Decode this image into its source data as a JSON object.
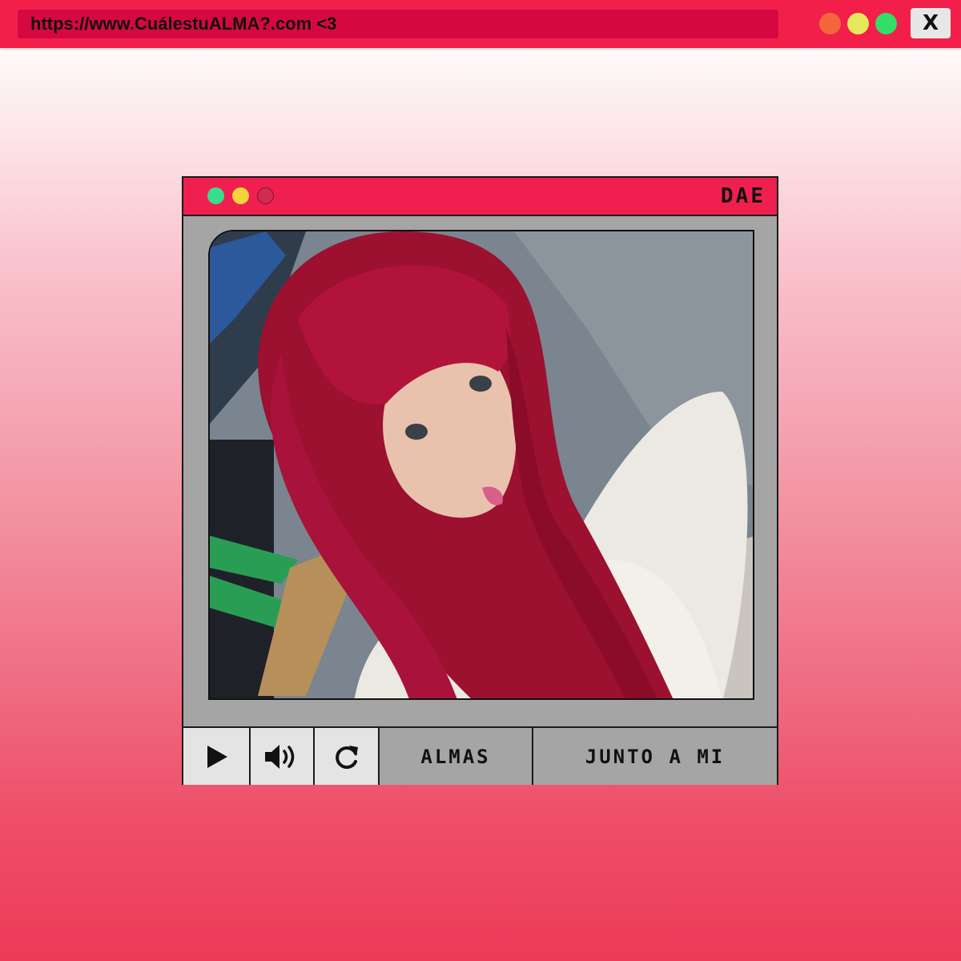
{
  "browser": {
    "url": "https://www.CuálestuALMA?.com <3",
    "close_label": "X",
    "colors": {
      "bar": "#f21f4a",
      "url_bar": "#d5093f",
      "dot_orange": "#f6663c",
      "dot_yellow": "#e6e85c",
      "dot_green": "#34dd67"
    }
  },
  "player": {
    "title": "DAE",
    "title_dots": [
      "green-dot",
      "yellow-dot",
      "red-dot"
    ],
    "photo": "red-haired-selfie-photo",
    "controls": {
      "play_icon": "play-icon",
      "volume_icon": "volume-icon",
      "replay_icon": "replay-icon",
      "tab1_label": "ALMAS",
      "tab2_label": "JUNTO A MI"
    },
    "colors": {
      "titlebar": "#ef2050",
      "body": "#a5a5a5",
      "button": "#e4e4e4"
    }
  }
}
